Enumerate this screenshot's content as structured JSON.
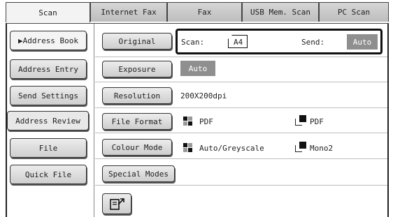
{
  "tabs": [
    "Scan",
    "Internet Fax",
    "Fax",
    "USB Mem. Scan",
    "PC Scan"
  ],
  "sidebar": {
    "items": [
      {
        "label": "▶Address Book"
      },
      {
        "label": "Address Entry"
      },
      {
        "label": "Send Settings"
      },
      {
        "label": "Address Review"
      },
      {
        "label": "File"
      },
      {
        "label": "Quick File"
      }
    ]
  },
  "settings": {
    "original": {
      "button": "Original",
      "scan_label": "Scan:",
      "scan_size": "A4",
      "send_label": "Send:",
      "send_value": "Auto"
    },
    "exposure": {
      "button": "Exposure",
      "value": "Auto"
    },
    "resolution": {
      "button": "Resolution",
      "value": "200X200dpi"
    },
    "file_format": {
      "button": "File Format",
      "color_value": "PDF",
      "mono_value": "PDF"
    },
    "colour_mode": {
      "button": "Colour Mode",
      "color_value": "Auto/Greyscale",
      "mono_value": "Mono2"
    },
    "special_modes": {
      "button": "Special Modes"
    }
  },
  "icons": {
    "bottom_button": "preview-icon"
  },
  "colors": {
    "badge": "#8f8f8f",
    "tab_active": "#f3f3f3",
    "tab_inactive": "#c8c8c8"
  }
}
